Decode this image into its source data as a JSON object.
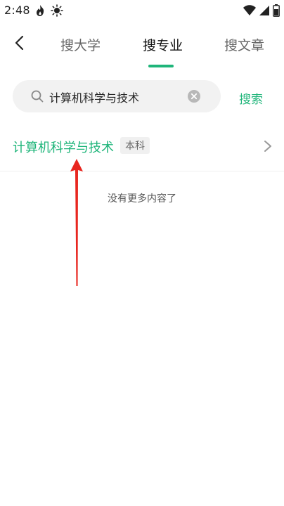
{
  "status_bar": {
    "time": "2:48"
  },
  "tabs": [
    {
      "label": "搜大学",
      "active": false
    },
    {
      "label": "搜专业",
      "active": true
    },
    {
      "label": "搜文章",
      "active": false
    }
  ],
  "search": {
    "value": "计算机科学与技术",
    "button_label": "搜索"
  },
  "results": [
    {
      "title": "计算机科学与技术",
      "badge": "本科"
    }
  ],
  "end_text": "没有更多内容了",
  "colors": {
    "accent": "#1fb57a",
    "annotation_arrow": "#e8261f"
  }
}
